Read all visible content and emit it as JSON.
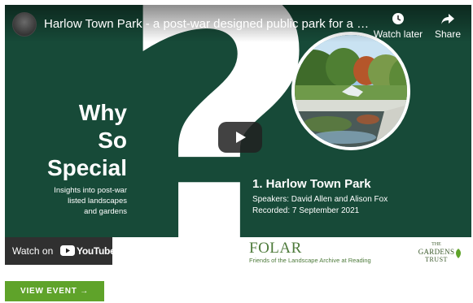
{
  "video": {
    "title": "Harlow Town Park - a post-war designed public park for a New T...",
    "watch_later_label": "Watch later",
    "share_label": "Share"
  },
  "slide": {
    "heading_lines": [
      "Why",
      "So",
      "Special"
    ],
    "subheading_lines": [
      "Insights into post-war",
      "listed landscapes",
      "and gardens"
    ],
    "talk_title": "1. Harlow Town Park",
    "speakers": "Speakers: David Allen and Alison Fox",
    "recorded": "Recorded: 7 September 2021"
  },
  "player": {
    "watch_on_label": "Watch on",
    "youtube_wordmark": "YouTube"
  },
  "logos": {
    "folar_mark": "FOLAR",
    "folar_subtitle": "Friends of the Landscape Archive at Reading",
    "gardens_trust_the": "THE",
    "gardens_trust_gardens": "GARDENS",
    "gardens_trust_trust": "TRUST"
  },
  "cta": {
    "view_event_label": "VIEW EVENT →"
  },
  "colors": {
    "slide_background": "#174a38",
    "cta_green": "#5fa32a",
    "folar_green": "#4d7a3a"
  }
}
